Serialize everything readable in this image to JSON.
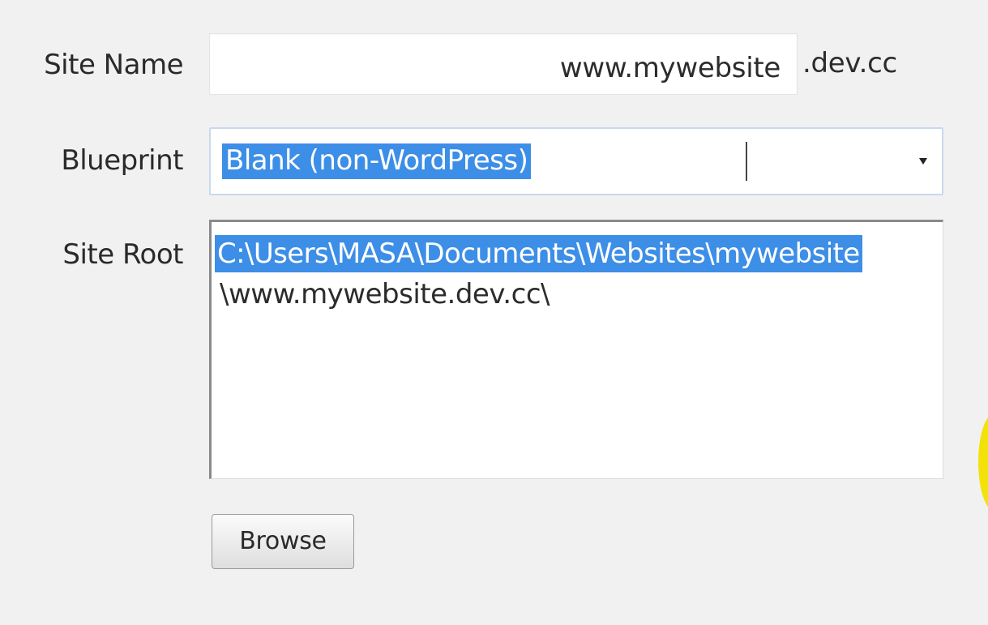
{
  "form": {
    "site_name": {
      "label": "Site Name",
      "value": "www.mywebsite",
      "suffix": ".dev.cc"
    },
    "blueprint": {
      "label": "Blueprint",
      "selected": "Blank (non-WordPress)"
    },
    "site_root": {
      "label": "Site Root",
      "line1": "C:\\Users\\MASA\\Documents\\Websites\\mywebsite",
      "line2": "\\www.mywebsite.dev.cc\\"
    },
    "browse_label": "Browse"
  },
  "colors": {
    "selection": "#3d8ee6",
    "cursor_highlight": "#f2e20a"
  },
  "icons": {
    "dropdown": "chevron-down-icon"
  }
}
